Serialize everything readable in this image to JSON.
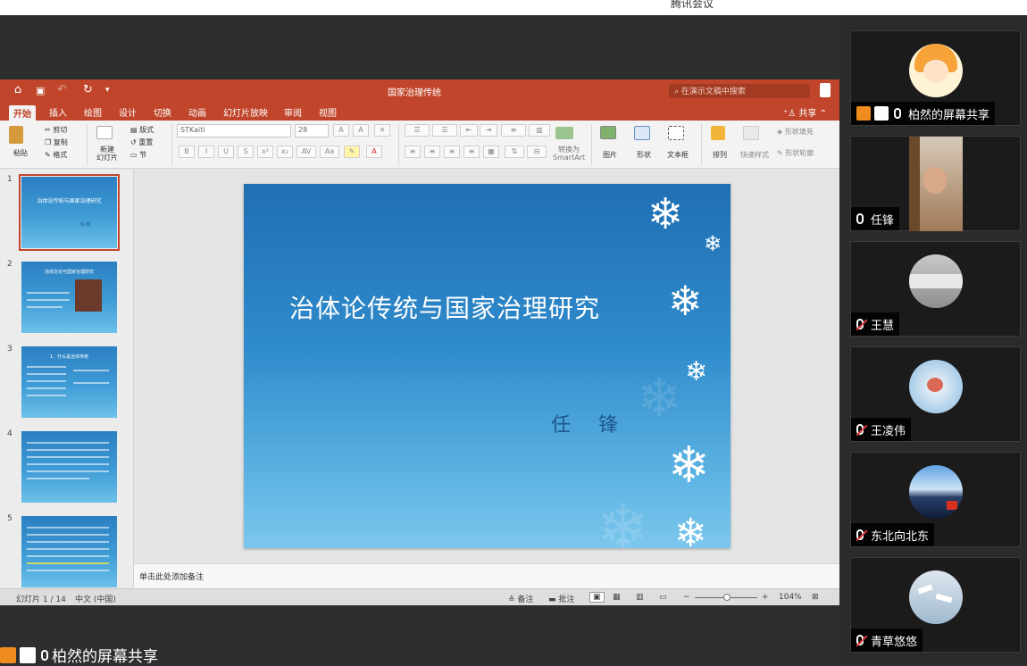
{
  "app": {
    "title": "腾讯会议"
  },
  "ppt": {
    "doc_title": "国家治理传统",
    "search_placeholder": "在演示文稿中搜索",
    "tabs": [
      "开始",
      "插入",
      "绘图",
      "设计",
      "切换",
      "动画",
      "幻灯片放映",
      "审阅",
      "视图"
    ],
    "share_label": "共享",
    "ribbon": {
      "paste": "粘贴",
      "cut": "剪切",
      "copy": "复制",
      "format": "格式",
      "new_slide": "新建\n幻灯片",
      "layout": "版式",
      "reset": "重置",
      "section": "节",
      "font_name": "STKaiti",
      "font_size": "28",
      "convert_smartart": "转换为\nSmartArt",
      "picture": "图片",
      "shape": "形状",
      "textbox": "文本框",
      "arrange": "排列",
      "quick_styles": "快速样式",
      "shape_fill": "形状填充",
      "shape_outline": "形状轮廓"
    },
    "thumbnails": [
      {
        "num": "1",
        "title": "治体论传统与国家治理研究",
        "sub": "任 锋"
      },
      {
        "num": "2",
        "title": "治体治论与国家治理研究"
      },
      {
        "num": "3",
        "title": "1、什么是治体传统"
      },
      {
        "num": "4",
        "title": ""
      },
      {
        "num": "5",
        "title": ""
      }
    ],
    "slide": {
      "title": "治体论传统与国家治理研究",
      "author": "任 锋"
    },
    "notes_placeholder": "单击此处添加备注",
    "status": {
      "slide_count": "幻灯片 1 / 14",
      "language": "中文 (中国)",
      "notes": "备注",
      "comments": "批注",
      "zoom": "104%"
    }
  },
  "share_bar": {
    "label": "柏然的屏幕共享"
  },
  "participants": [
    {
      "name": "柏然的屏幕共享",
      "muted": false,
      "sharing": true
    },
    {
      "name": "任锋",
      "muted": false
    },
    {
      "name": "王慧",
      "muted": true
    },
    {
      "name": "王凌伟",
      "muted": true
    },
    {
      "name": "东北向北东",
      "muted": true
    },
    {
      "name": "青草悠悠",
      "muted": true
    }
  ]
}
